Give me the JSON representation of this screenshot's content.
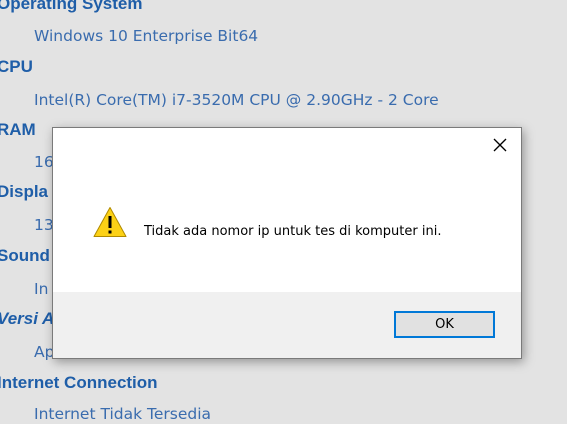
{
  "info": {
    "sections": [
      {
        "heading": "Operating System",
        "value": "Windows 10 Enterprise  Bit64"
      },
      {
        "heading": "CPU",
        "value": "Intel(R) Core(TM) i7-3520M CPU @ 2.90GHz - 2 Core"
      },
      {
        "heading": "RAM",
        "value": "16"
      },
      {
        "heading": "Displa",
        "value": "13"
      },
      {
        "heading": "Sound",
        "value": "In"
      },
      {
        "heading": "Versi A",
        "value": "Ap"
      },
      {
        "heading": "Internet Connection",
        "value": "Internet Tidak Tersedia"
      }
    ]
  },
  "dialog": {
    "message": "Tidak ada nomor ip untuk tes di komputer ini.",
    "ok_label": "OK",
    "icon": "warning-icon"
  },
  "colors": {
    "heading": "#1f5ea8",
    "value": "#3a6cae",
    "warning_fill": "#fcd116",
    "button_border": "#0078d7"
  }
}
